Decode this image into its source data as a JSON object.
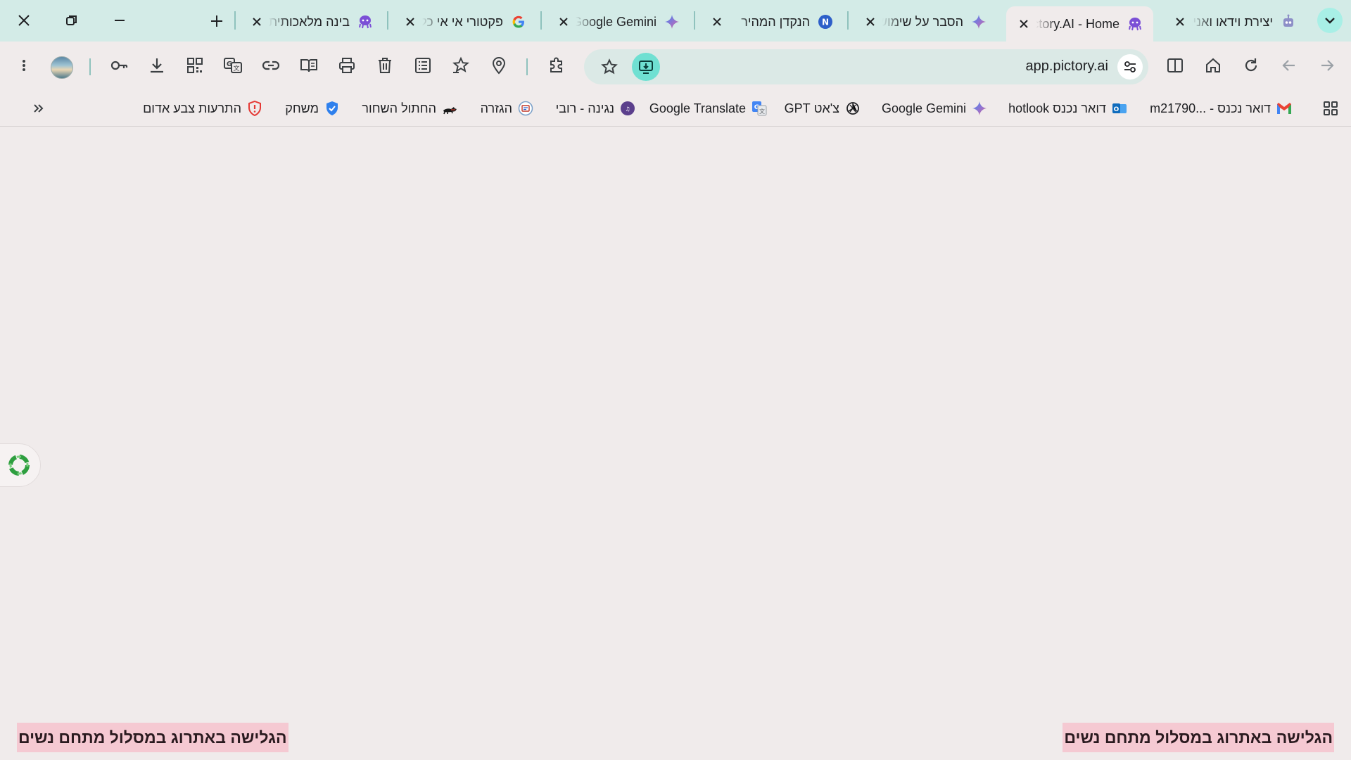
{
  "window": {
    "close_label": "✕",
    "restore_label": "❐",
    "minimize_label": "—",
    "newtab_label": "+"
  },
  "tabs": [
    {
      "title": "יצירת וידאו ואנימציה",
      "favicon": "robot-icon"
    },
    {
      "title": "Pictory.AI - Home",
      "favicon": "octopus-icon",
      "active": true
    },
    {
      "title": "הסבר על שימוש",
      "favicon": "gemini-icon"
    },
    {
      "title": "הנקדן המהיר",
      "favicon": "n-circle-icon"
    },
    {
      "title": "Google Gemini",
      "favicon": "gemini-icon"
    },
    {
      "title": "פקטורי אי אי כללי",
      "favicon": "google-icon"
    },
    {
      "title": "בינה מלאכותית",
      "favicon": "octopus-icon"
    }
  ],
  "omnibox": {
    "url": "app.pictory.ai"
  },
  "bookmarks": [
    {
      "label": "דואר נכנס - ...m21790",
      "favicon": "gmail-icon"
    },
    {
      "label": "דואר נכנס hotlook",
      "favicon": "outlook-icon"
    },
    {
      "label": "Google Gemini",
      "favicon": "gemini-icon"
    },
    {
      "label": "צ'אט GPT",
      "favicon": "openai-icon"
    },
    {
      "label": "Google Translate",
      "favicon": "translate-icon"
    },
    {
      "label": "נגינה - רובי",
      "favicon": "music-circle-icon"
    },
    {
      "label": "הגזרה",
      "favicon": "news-circle-icon"
    },
    {
      "label": "החתול השחור",
      "favicon": "cat-icon"
    },
    {
      "label": "משחק",
      "favicon": "verified-shield-icon"
    },
    {
      "label": "התרעות צבע אדום",
      "favicon": "red-shield-icon"
    }
  ],
  "content": {
    "caption_left": "הגלישה באתרוג במסלול מתחם נשים",
    "caption_right": "הגלישה באתרוג במסלול מתחם נשים"
  },
  "colors": {
    "tabstrip": "#d3ebe7",
    "page_bg": "#f0ebeb",
    "accent": "#6fe0d2",
    "caption_bg": "#f5c9d2"
  }
}
